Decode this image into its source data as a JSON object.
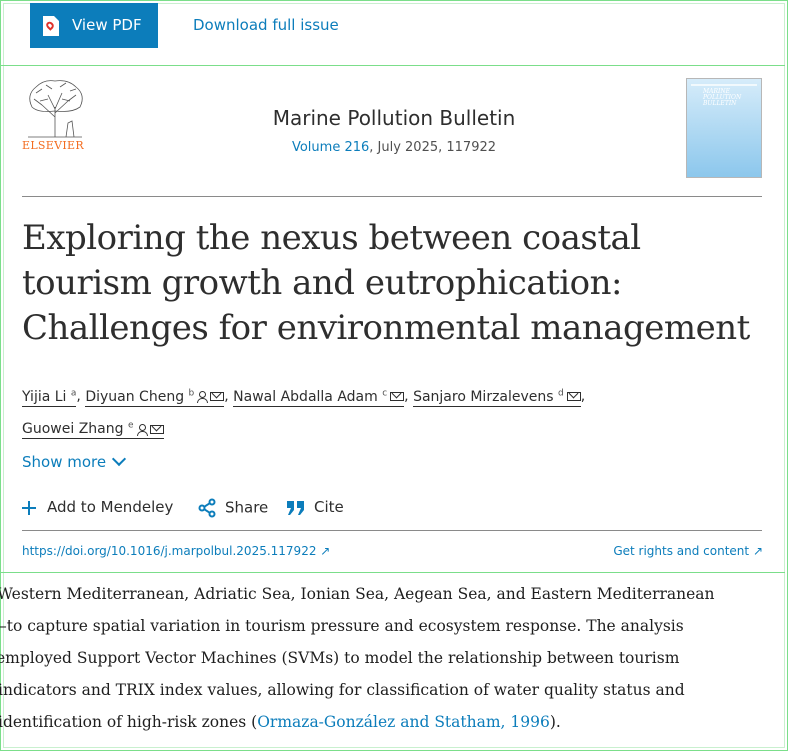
{
  "toolbar": {
    "view_pdf_label": "View PDF",
    "download_label": "Download full issue"
  },
  "journal": {
    "publisher": "ELSEVIER",
    "name": "Marine Pollution Bulletin",
    "volume_link": "Volume 216",
    "issue_info": ", July 2025, 117922",
    "cover_title": "MARINE POLLUTION BULLETIN"
  },
  "article": {
    "title_line1": "Exploring the nexus between coastal",
    "title_line2": "tourism growth and eutrophication:",
    "title_line3": "Challenges for environmental management",
    "authors": [
      {
        "name": "Yijia Li",
        "sup": "a"
      },
      {
        "name": "Diyuan Cheng",
        "sup": "b"
      },
      {
        "name": "Nawal Abdalla Adam",
        "sup": "c"
      },
      {
        "name": "Sanjaro Mirzalevens",
        "sup": "d"
      },
      {
        "name": "Guowei Zhang",
        "sup": "e"
      }
    ],
    "show_more": "Show more",
    "doi": "https://doi.org/10.1016/j.marpolbul.2025.117922",
    "rights": "Get rights and content"
  },
  "actions": {
    "mendeley": "Add to Mendeley",
    "share": "Share",
    "cite": "Cite"
  },
  "excerpt": {
    "line1": "Western Mediterranean, Adriatic Sea, Ionian Sea, Aegean Sea, and Eastern Mediterranean",
    "line2": "–to capture spatial variation in tourism pressure and ecosystem response. The analysis",
    "line3": "employed Support Vector Machines (SVMs) to model the relationship between tourism",
    "line4": "indicators and TRIX index values, allowing for classification of water quality status and",
    "line5_start": "identification of high-risk zones (",
    "line5_ref": "Ormaza-González and Statham, 1996",
    "line5_end": ")."
  },
  "colors": {
    "accent": "#0c7dbb",
    "elsevier_orange": "#f36d21",
    "frame_green": "#7bde8a"
  }
}
